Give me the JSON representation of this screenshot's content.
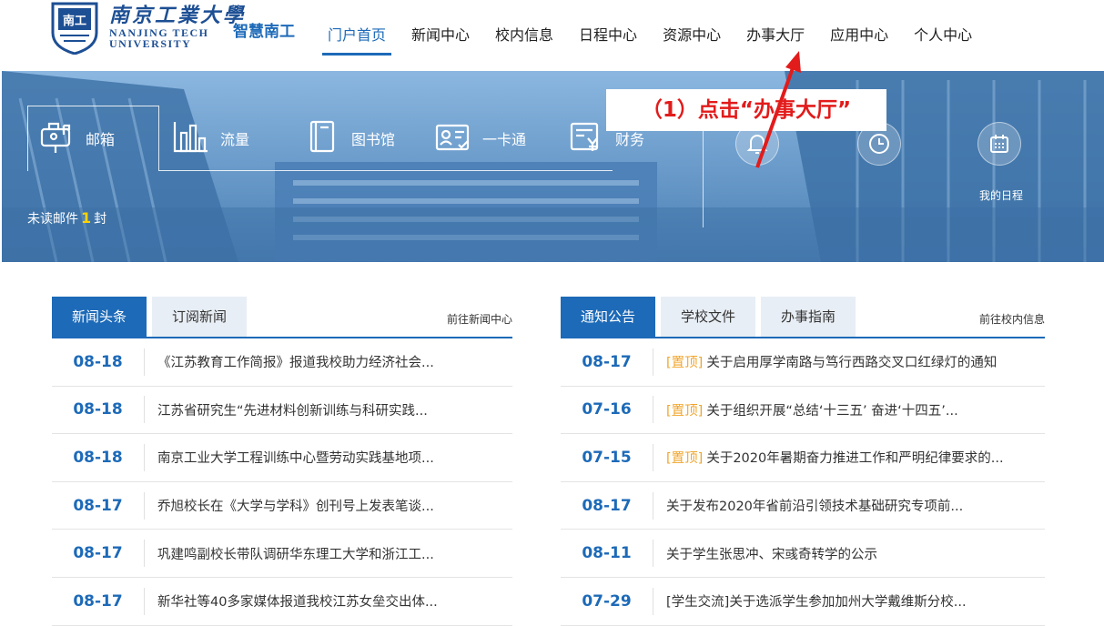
{
  "header": {
    "logo_cn": "南京工業大學",
    "logo_en_1": "NANJING TECH",
    "logo_en_2": "UNIVERSITY",
    "brand": "智慧南工",
    "nav": [
      {
        "label": "门户首页",
        "active": true
      },
      {
        "label": "新闻中心"
      },
      {
        "label": "校内信息"
      },
      {
        "label": "日程中心"
      },
      {
        "label": "资源中心"
      },
      {
        "label": "办事大厅"
      },
      {
        "label": "应用中心"
      },
      {
        "label": "个人中心"
      }
    ]
  },
  "banner": {
    "quick": [
      {
        "label": "邮箱",
        "icon": "mailbox-icon"
      },
      {
        "label": "流量",
        "icon": "bar-chart-icon"
      },
      {
        "label": "图书馆",
        "icon": "book-icon"
      },
      {
        "label": "一卡通",
        "icon": "id-card-icon"
      },
      {
        "label": "财务",
        "icon": "finance-icon"
      }
    ],
    "unread_prefix": "未读邮件",
    "unread_count": "1",
    "unread_suffix": "封",
    "my_schedule": "我的日程"
  },
  "callout": "（1）点击“办事大厅”",
  "left_panel": {
    "tabs": [
      "新闻头条",
      "订阅新闻"
    ],
    "more": "前往新闻中心",
    "rows": [
      {
        "date": "08-18",
        "title": "《江苏教育工作简报》报道我校助力经济社会..."
      },
      {
        "date": "08-18",
        "title": "江苏省研究生“先进材料创新训练与科研实践..."
      },
      {
        "date": "08-18",
        "title": "南京工业大学工程训练中心暨劳动实践基地项..."
      },
      {
        "date": "08-17",
        "title": "乔旭校长在《大学与学科》创刊号上发表笔谈..."
      },
      {
        "date": "08-17",
        "title": "巩建鸣副校长带队调研华东理工大学和浙江工..."
      },
      {
        "date": "08-17",
        "title": "新华社等40多家媒体报道我校江苏女垒交出体..."
      }
    ]
  },
  "right_panel": {
    "tabs": [
      "通知公告",
      "学校文件",
      "办事指南"
    ],
    "more": "前往校内信息",
    "rows": [
      {
        "date": "08-17",
        "tag": "[置顶]",
        "title": "关于启用厚学南路与笃行西路交叉口红绿灯的通知"
      },
      {
        "date": "07-16",
        "tag": "[置顶]",
        "title": "关于组织开展“总结‘十三五’ 奋进‘十四五’..."
      },
      {
        "date": "07-15",
        "tag": "[置顶]",
        "title": "关于2020年暑期奋力推进工作和严明纪律要求的..."
      },
      {
        "date": "08-17",
        "tag": "",
        "title": "关于发布2020年省前沿引领技术基础研究专项前..."
      },
      {
        "date": "08-11",
        "tag": "",
        "title": "关于学生张思冲、宋彧奇转学的公示"
      },
      {
        "date": "07-29",
        "tag": "",
        "title": "[学生交流]关于选派学生参加加州大学戴维斯分校..."
      }
    ]
  },
  "colors": {
    "accent": "#1d6ab8",
    "callout": "#e21b1b",
    "pinned": "#f0a52a",
    "unread": "#ffd200"
  }
}
